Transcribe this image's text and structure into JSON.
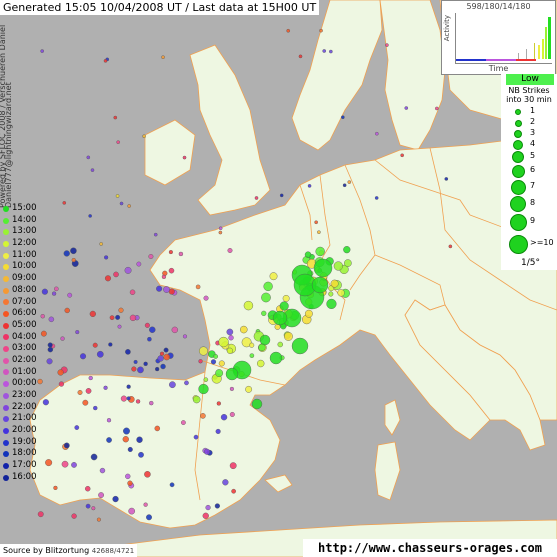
{
  "header": {
    "generated": "Generated 15:05 10/04/2008 UT / Last data at 15H00 UT"
  },
  "credits": {
    "line1": "Powered by SFLOC 2008 / Verschueren Daniel",
    "line2": "Daniel777@lightningwizard.net"
  },
  "activity": {
    "title": "598/180/14/180",
    "ylabel": "Activity",
    "xlabel": "Time"
  },
  "legend": {
    "level": "Low",
    "title_line1": "NB Strikes",
    "title_line2": "into 30 min",
    "sizes": [
      "1",
      "2",
      "3",
      "4",
      "5",
      "6",
      "7",
      "8",
      "9",
      ">=10"
    ],
    "scale": "1/5°"
  },
  "time_scale": {
    "labels": [
      "15:00",
      "14:00",
      "13:00",
      "12:00",
      "11:00",
      "10:00",
      "09:00",
      "08:00",
      "07:00",
      "06:00",
      "05:00",
      "04:00",
      "03:00",
      "02:00",
      "01:00",
      "00:00",
      "23:00",
      "22:00",
      "21:00",
      "20:00",
      "19:00",
      "18:00",
      "17:00",
      "16:00"
    ],
    "colors": [
      "#22dd22",
      "#55ee33",
      "#99f233",
      "#d4f533",
      "#eeee44",
      "#f5dd33",
      "#f5b833",
      "#f59933",
      "#f57733",
      "#f55522",
      "#ee3333",
      "#ee3366",
      "#ee4488",
      "#e055aa",
      "#d055c0",
      "#bb55dd",
      "#a055dd",
      "#8044dd",
      "#6644dd",
      "#4433dd",
      "#2233cc",
      "#1133bb",
      "#1122aa",
      "#112299"
    ]
  },
  "source": {
    "label": "Source by Blitzortung",
    "count": "42688/4721"
  },
  "site": {
    "url": "http://www.chasseurs-orages.com"
  },
  "colors": {
    "land": "#eef7e2",
    "sea": "#b0b0b0",
    "border": "#f0a050"
  }
}
